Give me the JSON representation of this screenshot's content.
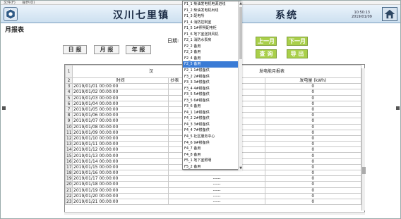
{
  "menubar": {
    "items": [
      "文件(F)",
      "操作(O)"
    ]
  },
  "header": {
    "title": "汉川七里镇光伏电站 ... 系统",
    "title_left": "汉川七里镇",
    "title_right": "系统",
    "time": "10:50:13",
    "date": "2019/01/09"
  },
  "page_title": "月报表",
  "date_label": "日期:",
  "buttons": {
    "daily": "日 报",
    "monthly": "月 报",
    "yearly": "年 报",
    "prev_month": "上一月",
    "next_month": "下一月",
    "query": "查 询",
    "export": "导 出"
  },
  "sheet": {
    "title": "汉川七里镇光伏电站发电能月报表",
    "title_visible_left": "汉",
    "title_visible_right": "发电能月报表",
    "headers": {
      "time": "时间",
      "meter": "抄表",
      "generation": "发电量 (kWh)"
    },
    "row_numbers": [
      "1",
      "2",
      "3",
      "4",
      "5",
      "6",
      "7",
      "8",
      "9",
      "10",
      "11",
      "12",
      "13",
      "14",
      "15",
      "16",
      "17",
      "18",
      "19",
      "20",
      "21",
      "22",
      "23"
    ],
    "rows": [
      {
        "time": "2019/01/01 00:00:00",
        "meter": "",
        "gen": "0"
      },
      {
        "time": "2019/01/02 00:00:00",
        "meter": "",
        "gen": "0"
      },
      {
        "time": "2019/01/03 00:00:00",
        "meter": "",
        "gen": "0"
      },
      {
        "time": "2019/01/04 00:00:00",
        "meter": "",
        "gen": "0"
      },
      {
        "time": "2019/01/05 00:00:00",
        "meter": "",
        "gen": "0"
      },
      {
        "time": "2019/01/06 00:00:00",
        "meter": "",
        "gen": "0"
      },
      {
        "time": "2019/01/07 00:00:00",
        "meter": "",
        "gen": "0"
      },
      {
        "time": "2019/01/08 00:00:00",
        "meter": "",
        "gen": "0"
      },
      {
        "time": "2019/01/09 00:00:00",
        "meter": "",
        "gen": "0"
      },
      {
        "time": "2019/01/10 00:00:00",
        "meter": "",
        "gen": "0"
      },
      {
        "time": "2019/01/11 00:00:00",
        "meter": "",
        "gen": "0"
      },
      {
        "time": "2019/01/12 00:00:00",
        "meter": "",
        "gen": "0"
      },
      {
        "time": "2019/01/13 00:00:00",
        "meter": "",
        "gen": "0"
      },
      {
        "time": "2019/01/14 00:00:00",
        "meter": "",
        "gen": "0"
      },
      {
        "time": "2019/01/15 00:00:00",
        "meter": "",
        "gen": "0"
      },
      {
        "time": "2019/01/16 00:00:00",
        "meter": "",
        "gen": "0"
      },
      {
        "time": "2019/01/17 00:00:00",
        "meter": "-----",
        "gen": "0"
      },
      {
        "time": "2019/01/18 00:00:00",
        "meter": "-----",
        "gen": "0"
      },
      {
        "time": "2019/01/19 00:00:00",
        "meter": "-----",
        "gen": "0"
      },
      {
        "time": "2019/01/20 00:00:00",
        "meter": "-----",
        "gen": "0"
      },
      {
        "time": "2019/01/21 00:00:00",
        "meter": "-----",
        "gen": "0"
      }
    ]
  },
  "dropdown": {
    "items": [
      "F1_1 柴油发电机电源进线",
      "F1_2 柴油发电机出线",
      "F1_3 配电所",
      "F1_4 消防控制室",
      "F1_5 1#照明配电柜",
      "F1_6 地下室送排风机",
      "F2_1 消防水泵房",
      "F2_2 备用",
      "F2_3 备用",
      "F2_4 备用",
      "F2_5 备用",
      "F2_1 1#楼备供",
      "F3_2 2#楼备供",
      "F3_3 3#楼备供",
      "F3_4 4#楼备供",
      "F3_5 5#楼备供",
      "F3_5 6#楼备供",
      "F3_6 备用",
      "F4_1 1#楼备供",
      "F4_2 2#楼备供",
      "F4_3 3#楼备供",
      "F4_4 7#楼备供",
      "F4_5 社区服务中心",
      "F4_6 9#楼备供",
      "F4_7 备用",
      "F4_8 备用",
      "F5_1 地下室照明",
      "F5_2 备用"
    ],
    "selected_index": 10
  }
}
